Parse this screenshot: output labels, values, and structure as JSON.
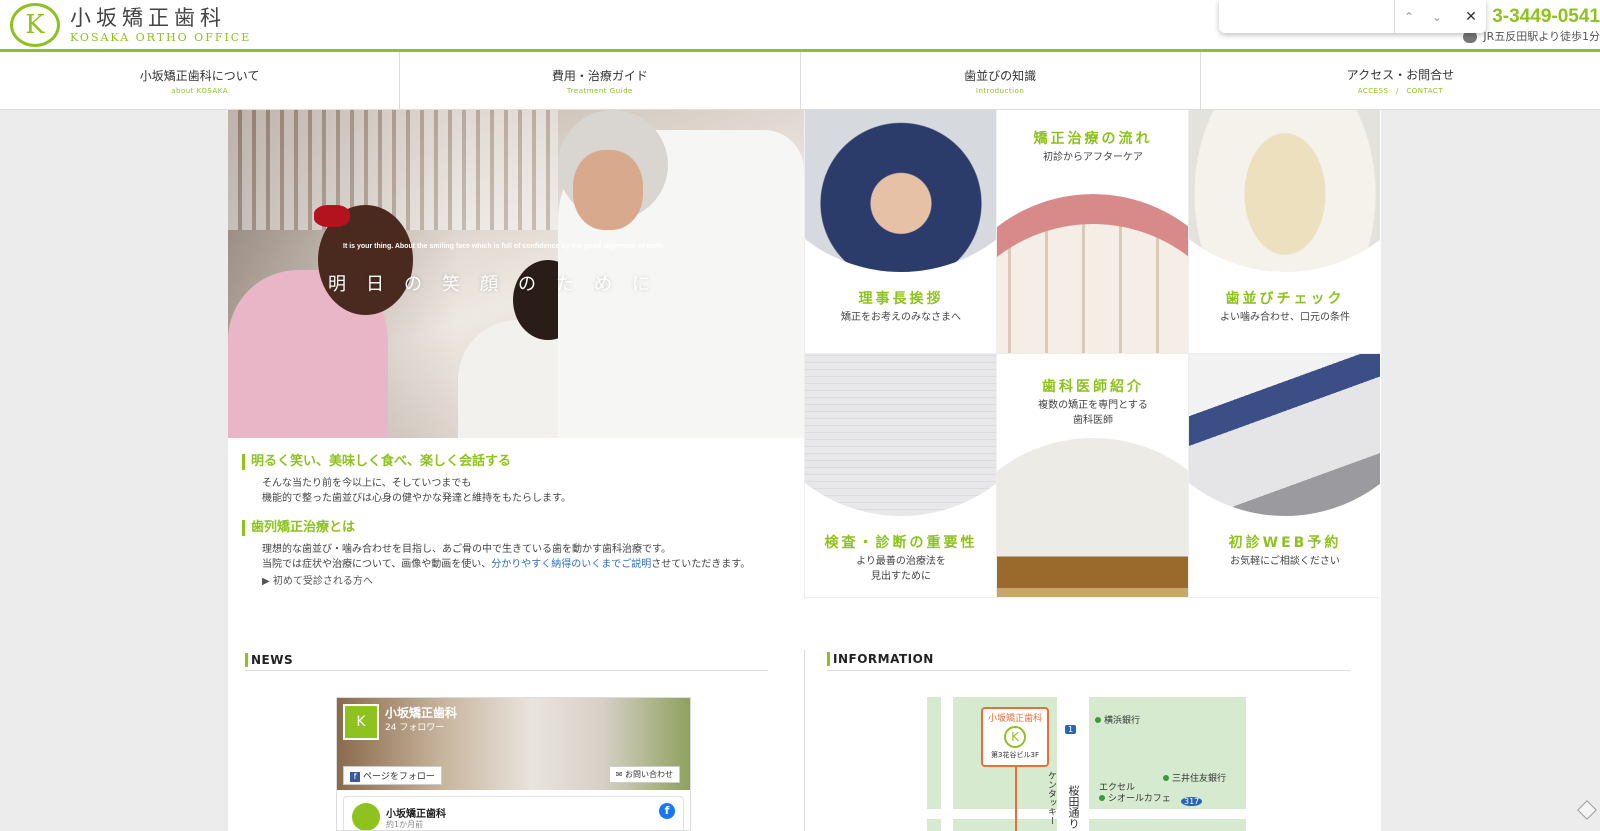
{
  "header": {
    "logo_mark": "K",
    "logo_ja": "小坂矯正歯科",
    "logo_en": "KOSAKA ORTHO OFFICE",
    "phone": "3-3449-0541",
    "station": "JR五反田駅より徒歩1分",
    "accent_color": "#8dc21f"
  },
  "findbar": {
    "value": "",
    "prev_icon": "chevron-up-icon",
    "next_icon": "chevron-down-icon",
    "close_icon": "close-icon"
  },
  "nav": {
    "items": [
      {
        "ja": "小坂矯正歯科について",
        "en": "about KOSAKA"
      },
      {
        "ja": "費用・治療ガイド",
        "en": "Treatment Guide"
      },
      {
        "ja": "歯並びの知識",
        "en": "Introduction"
      },
      {
        "ja": "アクセス・お問合せ",
        "en": "ACCESS　/　CONTACT"
      }
    ]
  },
  "hero": {
    "subtitle": "It is your thing. About the smiling face which is full of confidence by the good alignment of teeth.",
    "title": "明日の笑顔のために"
  },
  "intro": {
    "heading1": "明るく笑い、美味しく食べ、楽しく会話する",
    "para1_line1": "そんな当たり前を今以上に、そしていつまでも",
    "para1_line2": "機能的で整った歯並びは心身の健やかな発達と維持をもたらします。",
    "heading2": "歯列矯正治療とは",
    "para2_line1": "理想的な歯並び・噛み合わせを目指し、あご骨の中で生きている歯を動かす歯科治療です。",
    "para2_line2_a": "当院では症状や治療について、画像や動画を使い、",
    "para2_line2_link": "分かりやすく納得のいくまでご説明",
    "para2_line2_b": "させていただきます。",
    "first_visit": "▶ 初めて受診される方へ"
  },
  "tiles": [
    {
      "title": "理事長挨拶",
      "desc1": "矯正をお考えのみなさまへ",
      "desc2": ""
    },
    {
      "title": "矯正治療の流れ",
      "desc1": "初診からアフターケア",
      "desc2": ""
    },
    {
      "title": "歯並びチェック",
      "desc1": "よい噛み合わせ、口元の条件",
      "desc2": ""
    },
    {
      "title": "検査・診断の重要性",
      "desc1": "より最善の治療法を",
      "desc2": "見出すために"
    },
    {
      "title": "歯科医師紹介",
      "desc1": "複数の矯正を専門とする",
      "desc2": "歯科医師"
    },
    {
      "title": "初診WEB予約",
      "desc1": "お気軽にご相談ください",
      "desc2": ""
    }
  ],
  "news": {
    "title": "NEWS",
    "fb_page_name": "小坂矯正歯科",
    "fb_followers": "24 フォロワー",
    "fb_follow_label": "ページをフォロー",
    "fb_contact_label": "お問い合わせ",
    "fb_post_name": "小坂矯正歯科",
    "fb_post_time": "約1か月前",
    "fb_icon": "f"
  },
  "information": {
    "title": "INFORMATION",
    "map": {
      "marker_name": "小坂矯正歯科",
      "marker_mark": "K",
      "marker_building": "第3花谷ビル3F",
      "label_bank1": "横浜銀行",
      "label_bank2": "三井住友銀行",
      "label_cafe_line1": "エクセル",
      "label_cafe_line2": "シオールカフェ",
      "label_kfc": "ケンタッキー",
      "label_street": "桜田通り",
      "route1": "1",
      "route317": "317"
    }
  }
}
